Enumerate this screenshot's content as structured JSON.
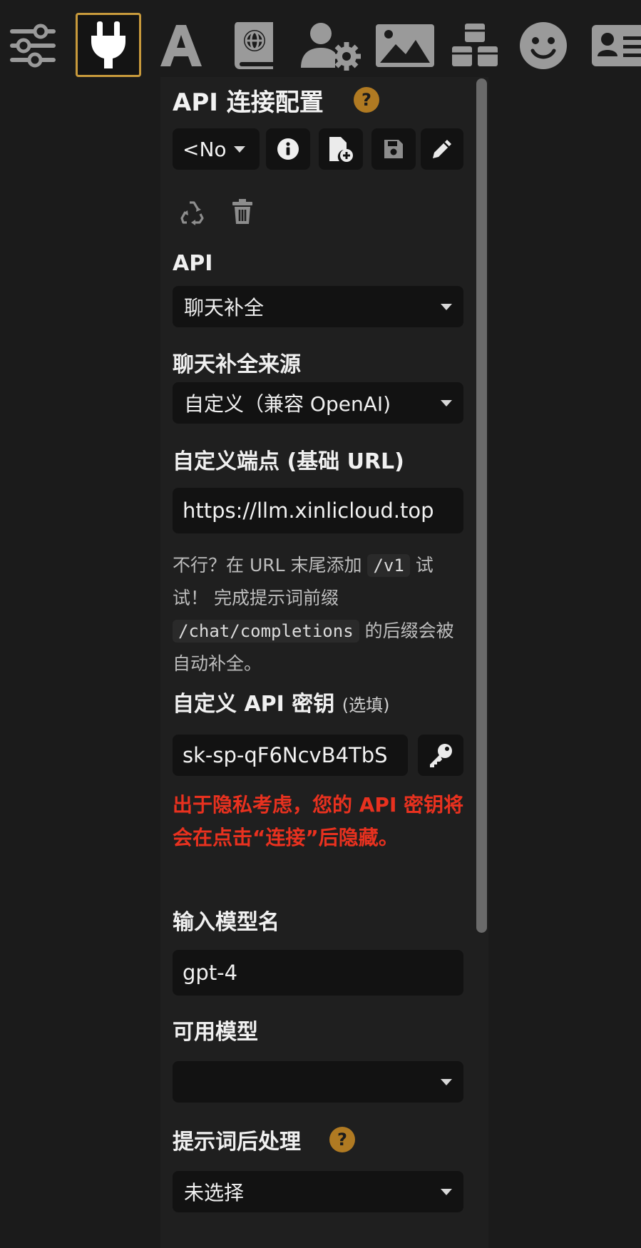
{
  "toolbar": {
    "icons": [
      "sliders-icon",
      "plug-icon",
      "font-icon",
      "book-globe-icon",
      "user-gear-icon",
      "image-icon",
      "cubes-icon",
      "smile-icon",
      "id-card-icon"
    ],
    "active_icon": "plug-icon",
    "active_border_color": "#c89a3c"
  },
  "panel": {
    "title": "API 连接配置",
    "help_badge": "?",
    "profile": {
      "selected": "<No"
    },
    "api": {
      "label": "API",
      "selected": "聊天补全"
    },
    "source": {
      "label": "聊天补全来源",
      "selected": "自定义（兼容 OpenAI)"
    },
    "endpoint": {
      "label": "自定义端点 (基础 URL)",
      "value": "https://llm.xinlicloud.top"
    },
    "hint": {
      "part1": "不行？在 URL 末尾添加",
      "code1": "/v1",
      "part2": "试试！ 完成提示词前缀",
      "code2": "/chat/completions",
      "part3": "的后缀会被自动补全。"
    },
    "api_key": {
      "label": "自定义 API 密钥",
      "optional": "(选填)",
      "value": "sk-sp-qF6NcvB4TbS"
    },
    "warning": "出于隐私考虑，您的 API 密钥将会在点击“连接”后隐藏。",
    "model_name": {
      "label": "输入模型名",
      "value": "gpt-4"
    },
    "available_models": {
      "label": "可用模型",
      "selected": ""
    },
    "postprocess": {
      "label": "提示词后处理",
      "help_badge": "?",
      "selected": "未选择"
    }
  },
  "colors": {
    "background": "#1b1b1b",
    "field_bg": "#121212",
    "help_badge": "#b07a22",
    "warning": "#e8311f"
  }
}
